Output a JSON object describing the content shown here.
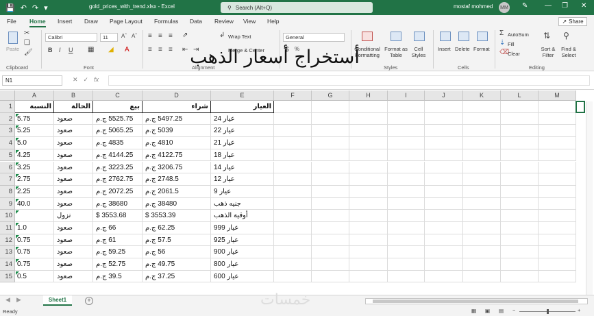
{
  "titlebar": {
    "filename": "gold_prices_with_trend.xlsx  -  Excel",
    "search_placeholder": "Search (Alt+Q)",
    "user_name": "mostaf mohmed",
    "user_initials": "MM"
  },
  "menu": {
    "tabs": [
      "File",
      "Home",
      "Insert",
      "Draw",
      "Page Layout",
      "Formulas",
      "Data",
      "Review",
      "View",
      "Help"
    ],
    "share": "Share"
  },
  "ribbon": {
    "paste": "Paste",
    "font_name": "Calibri",
    "font_size": "11",
    "wrap_text": "Wrap Text",
    "merge_center": "Merge & Center",
    "number_format": "General",
    "conditional_formatting": "Conditional Formatting",
    "format_as_table": "Format as Table",
    "cell_styles": "Cell Styles",
    "insert": "Insert",
    "delete": "Delete",
    "format": "Format",
    "autosum": "AutoSum",
    "fill": "Fill",
    "clear": "Clear",
    "sort_filter": "Sort & Filter",
    "find_select": "Find & Select",
    "groups": [
      "Clipboard",
      "Font",
      "Alignment",
      "Styles",
      "Cells",
      "Editing"
    ]
  },
  "overlay_title": "أستخراج أسعار الذهب",
  "formula_bar": {
    "name_box": "N1",
    "fx": "fx",
    "content": ""
  },
  "columns": [
    "A",
    "B",
    "C",
    "D",
    "E",
    "F",
    "G",
    "H",
    "I",
    "J",
    "K",
    "L",
    "M"
  ],
  "rows": [
    [
      "النسبة",
      "الحالة",
      "بيع",
      "شراء",
      "العيار"
    ],
    [
      "5.75",
      "صعود",
      "5525.75 ج.م",
      "5497.25 ج.م",
      "عيار 24"
    ],
    [
      "5.25",
      "صعود",
      "5065.25 ج.م",
      "5039 ج.م",
      "عيار 22"
    ],
    [
      "5.0",
      "صعود",
      "4835 ج.م",
      "4810 ج.م",
      "عيار 21"
    ],
    [
      "4.25",
      "صعود",
      "4144.25 ج.م",
      "4122.75 ج.م",
      "عيار 18"
    ],
    [
      "3.25",
      "صعود",
      "3223.25 ج.م",
      "3206.75 ج.م",
      "عيار 14"
    ],
    [
      "2.75",
      "صعود",
      "2762.75 ج.م",
      "2748.5 ج.م",
      "عيار 12"
    ],
    [
      "2.25",
      "صعود",
      "2072.25 ج.م",
      "2061.5 ج.م",
      "عيار 9"
    ],
    [
      "40.0",
      "صعود",
      "38680 ج.م",
      "38480 ج.م",
      "جنيه ذهب"
    ],
    [
      "",
      "نزول",
      "3553.68 $",
      "3553.39 $",
      "أوقية الذهب"
    ],
    [
      "1.0",
      "صعود",
      "66 ج.م",
      "62.25 ج.م",
      "عيار 999"
    ],
    [
      "0.75",
      "صعود",
      "61 ج.م",
      "57.5 ج.م",
      "عيار 925"
    ],
    [
      "0.75",
      "صعود",
      "59.25 ج.م",
      "56 ج.م",
      "عيار 900"
    ],
    [
      "0.75",
      "صعود",
      "52.75 ج.م",
      "49.75 ج.م",
      "عيار 800"
    ],
    [
      "0.5",
      "صعود",
      "39.5 ج.م",
      "37.25 ج.م",
      "عيار 600"
    ]
  ],
  "sheet_tab": "Sheet1",
  "status": {
    "ready": "Ready"
  },
  "watermark": "خمسات"
}
